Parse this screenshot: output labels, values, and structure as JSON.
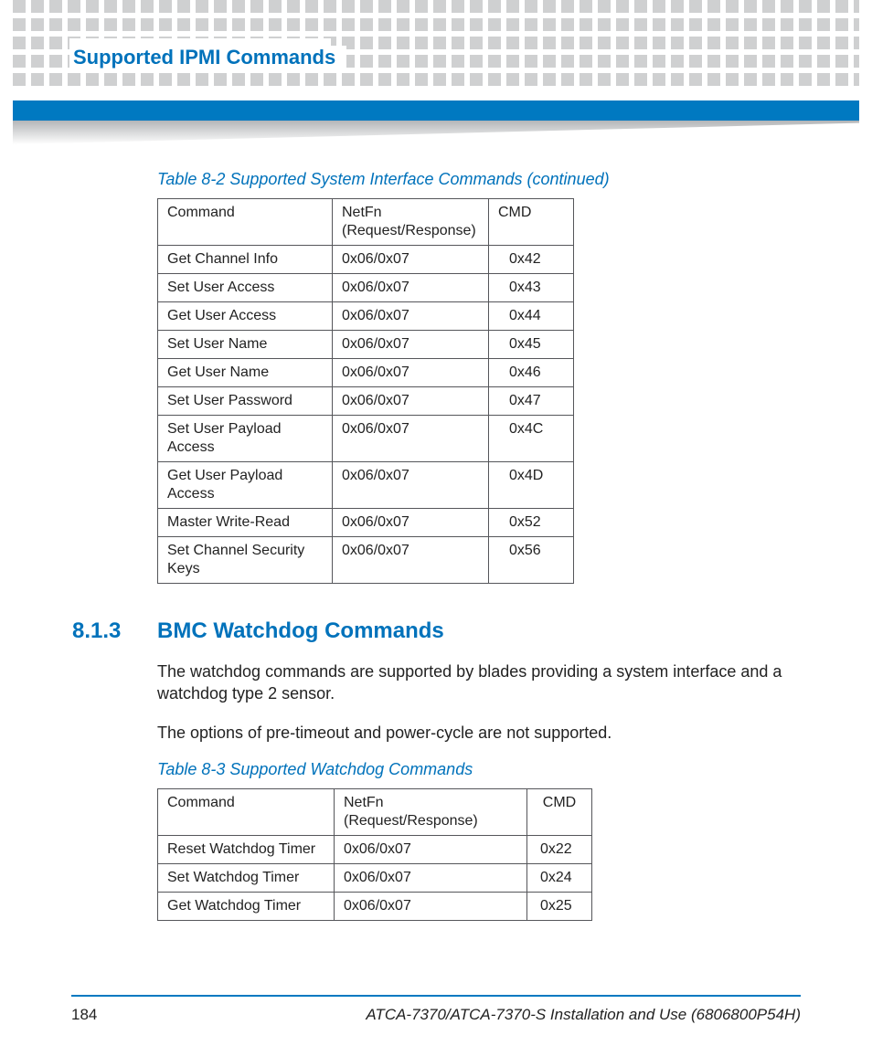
{
  "header": {
    "title": "Supported IPMI Commands"
  },
  "table1": {
    "caption": "Table 8-2 Supported System Interface Commands (continued)",
    "columns": {
      "c1": "Command",
      "c2": "NetFn (Request/Response)",
      "c3": "CMD"
    },
    "rows": [
      {
        "cmd": "Get Channel Info",
        "netfn": "0x06/0x07",
        "code": "0x42"
      },
      {
        "cmd": "Set User Access",
        "netfn": "0x06/0x07",
        "code": "0x43"
      },
      {
        "cmd": "Get User Access",
        "netfn": "0x06/0x07",
        "code": "0x44"
      },
      {
        "cmd": "Set User Name",
        "netfn": "0x06/0x07",
        "code": "0x45"
      },
      {
        "cmd": "Get User Name",
        "netfn": "0x06/0x07",
        "code": "0x46"
      },
      {
        "cmd": "Set User Password",
        "netfn": "0x06/0x07",
        "code": "0x47"
      },
      {
        "cmd": "Set User Payload Access",
        "netfn": "0x06/0x07",
        "code": "0x4C"
      },
      {
        "cmd": "Get User Payload Access",
        "netfn": "0x06/0x07",
        "code": "0x4D"
      },
      {
        "cmd": "Master Write-Read",
        "netfn": "0x06/0x07",
        "code": "0x52"
      },
      {
        "cmd": "Set Channel Security Keys",
        "netfn": "0x06/0x07",
        "code": "0x56"
      }
    ]
  },
  "section": {
    "number": "8.1.3",
    "title": "BMC Watchdog Commands",
    "para1": "The watchdog commands are supported by blades providing a system interface and a watchdog type 2 sensor.",
    "para2": "The options of pre-timeout and power-cycle are not supported."
  },
  "table2": {
    "caption": "Table 8-3 Supported Watchdog Commands",
    "columns": {
      "c1": "Command",
      "c2": "NetFn (Request/Response)",
      "c3": "CMD"
    },
    "rows": [
      {
        "cmd": "Reset Watchdog Timer",
        "netfn": "0x06/0x07",
        "code": "0x22"
      },
      {
        "cmd": "Set Watchdog Timer",
        "netfn": "0x06/0x07",
        "code": "0x24"
      },
      {
        "cmd": "Get Watchdog Timer",
        "netfn": "0x06/0x07",
        "code": "0x25"
      }
    ]
  },
  "footer": {
    "page": "184",
    "doc": "ATCA-7370/ATCA-7370-S Installation and Use (6806800P54H)"
  }
}
